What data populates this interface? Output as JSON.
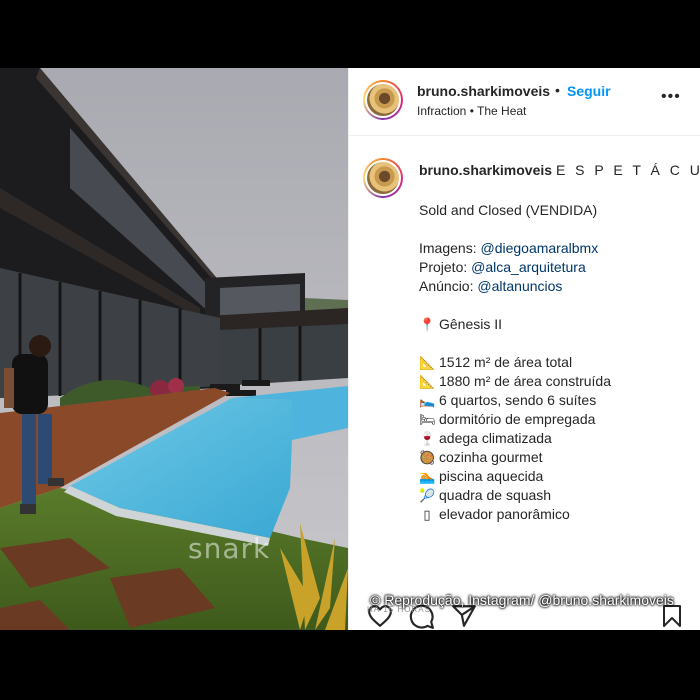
{
  "post": {
    "username": "bruno.sharkimoveis",
    "separator": "•",
    "follow_label": "Seguir",
    "audio": "Infraction • The Heat",
    "more_label": "•••"
  },
  "caption": {
    "username": "bruno.sharkimoveis",
    "title": "E S P E T Á C U L O !",
    "status": "Sold and Closed (VENDIDA)",
    "credits": [
      {
        "label": "Imagens:",
        "mention": "@diegoamaralbmx"
      },
      {
        "label": "Projeto:",
        "mention": "@alca_arquitetura"
      },
      {
        "label": "Anúncio:",
        "mention": "@altanuncios"
      }
    ],
    "location": {
      "icon": "📍",
      "text": "Gênesis II"
    },
    "features": [
      {
        "icon": "📐",
        "text": "1512 m² de área total"
      },
      {
        "icon": "📐",
        "text": "1880 m² de área construída"
      },
      {
        "icon": "🛌",
        "text": "6 quartos, sendo 6 suítes"
      },
      {
        "icon": "🛏",
        "text": "dormitório de empregada"
      },
      {
        "icon": "🍷",
        "text": "adega climatizada"
      },
      {
        "icon": "🥘",
        "text": "cozinha gourmet"
      },
      {
        "icon": "🏊",
        "text": "piscina aquecida"
      },
      {
        "icon": "🎾",
        "text": "quadra de squash"
      },
      {
        "icon": "▯",
        "text": "elevador panorâmico"
      }
    ]
  },
  "photo": {
    "watermark": "snark"
  },
  "footer": {
    "time": "HÁ 15 HORAS",
    "credit": "© Reprodução, Instagram/ @bruno.sharkimoveis"
  },
  "icons": {
    "like": "heart-icon",
    "comment": "comment-icon",
    "share": "send-icon",
    "save": "bookmark-icon"
  }
}
